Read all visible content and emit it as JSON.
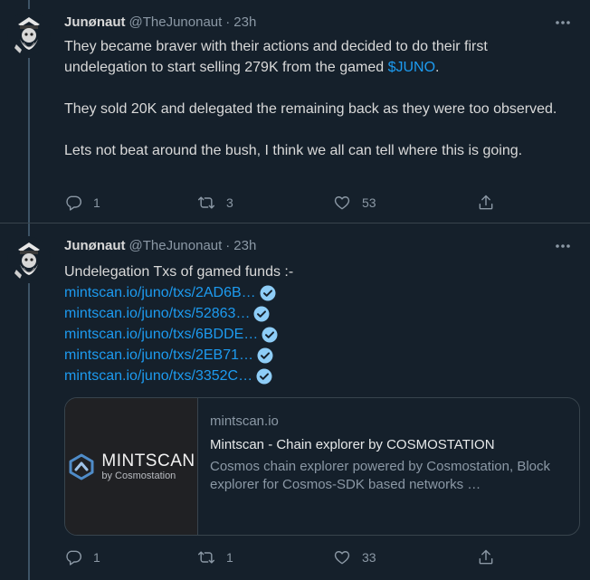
{
  "tweets": [
    {
      "author_name": "Junønaut",
      "author_handle": "@TheJunonaut",
      "separator": "·",
      "time": "23h",
      "text": {
        "p1_before": "They became braver with their actions and decided to do their first undelegation to start selling 279K from the gamed ",
        "cashtag": "$JUNO",
        "p1_after": ".",
        "p2": "They sold 20K and delegated the remaining back as they were too observed.",
        "p3": "Lets not beat around the bush, I think we all can tell where this is going."
      },
      "stats": {
        "replies": "1",
        "retweets": "3",
        "likes": "53"
      }
    },
    {
      "author_name": "Junønaut",
      "author_handle": "@TheJunonaut",
      "separator": "·",
      "time": "23h",
      "text": {
        "intro": "Undelegation Txs of gamed funds :-"
      },
      "links": [
        "mintscan.io/juno/txs/2AD6B…",
        "mintscan.io/juno/txs/52863…",
        "mintscan.io/juno/txs/6BDDE…",
        "mintscan.io/juno/txs/2EB71…",
        "mintscan.io/juno/txs/3352C…"
      ],
      "card": {
        "brand_name": "MINTSCAN",
        "brand_sub": "by Cosmostation",
        "domain": "mintscan.io",
        "title": "Mintscan - Chain explorer by COSMOSTATION",
        "description": "Cosmos chain explorer powered by Cosmostation, Block explorer for Cosmos-SDK based networks …"
      },
      "stats": {
        "replies": "1",
        "retweets": "1",
        "likes": "33"
      }
    }
  ],
  "icons": {
    "reply": "reply-icon",
    "retweet": "retweet-icon",
    "like": "heart-icon",
    "share": "share-icon",
    "more": "more-icon",
    "verified": "verified-badge-icon"
  },
  "colors": {
    "background": "#15202b",
    "link": "#1d9bf0",
    "muted": "#8b98a5",
    "border": "#38444d"
  }
}
